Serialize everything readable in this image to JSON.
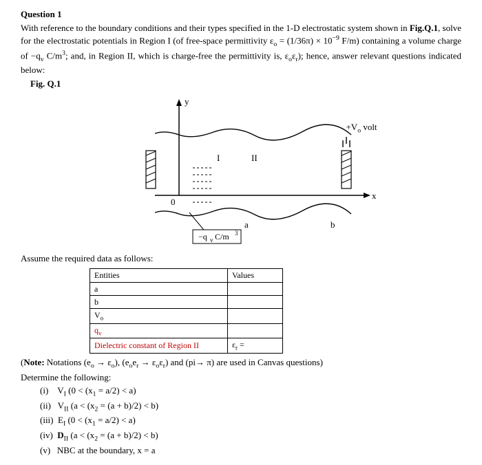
{
  "question_title": "Question 1",
  "paragraph_html": "With reference to the boundary conditions and their types specified in the 1-D electrostatic system shown in <b>Fig.Q.1</b>, solve for the electrostatic potentials in Region I (of free-space permittivity ε<sub>o</sub> = (1/36π) × 10<sup>−9</sup> F/m) containing a volume charge of −q<sub>v</sub> C/m<sup>3</sup>; and, in Region II, which is charge-free the permittivity is, ε<sub>o</sub>ε<sub>r</sub>); hence, answer relevant questions indicated below:",
  "fig_label": "Fig. Q.1",
  "figure": {
    "y_axis": "y",
    "x_axis": "x",
    "region1": "I",
    "region2": "II",
    "voltage": "+V<sub>o</sub> volt",
    "origin": "0",
    "charge_box": "−q<sub>v</sub> C/m<sup>3</sup>",
    "pt_a": "a",
    "pt_b": "b"
  },
  "assume_line": "Assume the required data as follows:",
  "table": {
    "header_entities": "Entities",
    "header_values": "Values",
    "row_a": "a",
    "row_b": "b",
    "row_vo": "V<sub>o</sub>",
    "row_qv": "q<sub>v</sub>",
    "row_diel": "Dielectric constant of Region II",
    "row_diel_val": "ε<sub>r</sub> ="
  },
  "note_html": "(<b>Note:</b> Notations (e<sub>o</sub> → ε<sub>o</sub>), (e<sub>o</sub>e<sub>r</sub> → ε<sub>o</sub>ε<sub>r</sub>) and (pi→ π) are used in Canvas questions)",
  "determine_title": "Determine the following:",
  "parts": {
    "i": "(i)&nbsp;&nbsp;&nbsp;&nbsp;V<sub>I</sub> (0 &lt; (x<sub>1</sub> = a/2) &lt; a)",
    "ii": "(ii)&nbsp;&nbsp;&nbsp;V<sub>II</sub> (a &lt; (x<sub>2</sub> = (a + b)/2) &lt; b)",
    "iii": "(iii)&nbsp;&nbsp;E<sub>I</sub> (0 &lt; (x<sub>1</sub> = a/2) &lt; a)",
    "iv": "(iv)&nbsp;&nbsp;<b>D</b><sub>II</sub> (a &lt; (x<sub>2</sub> = (a + b)/2) &lt; b)",
    "v": "(v)&nbsp;&nbsp;&nbsp;NBC at the boundary, x = a"
  }
}
